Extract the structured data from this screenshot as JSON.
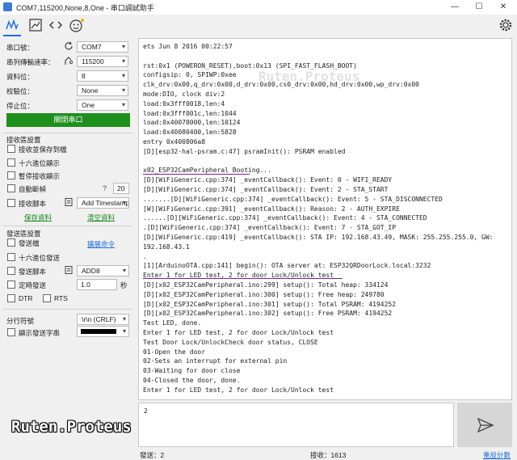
{
  "window": {
    "title": "COM7,115200,None,8,One - 串口調試助手",
    "minimize": "—",
    "maximize": "☐",
    "close": "✕"
  },
  "toolbar": {
    "icons": [
      "waveform-icon",
      "chart-icon",
      "code-icon",
      "emoji-icon"
    ],
    "settings_icon": "gear-icon"
  },
  "serial": {
    "port_label": "串口號：",
    "port_value": "COM7",
    "baud_label": "串列傳輸速率：",
    "baud_value": "115200",
    "data_bits_label": "資料位：",
    "data_bits_value": "8",
    "parity_label": "校驗位：",
    "parity_value": "None",
    "stop_bits_label": "停止位：",
    "stop_bits_value": "One",
    "close_port_button": "關閉串口"
  },
  "receive": {
    "section_title": "接收區設置",
    "save_to_file": "接收並保存到檔",
    "hex_display": "十六進位顯示",
    "pause_display": "暫停接收顯示",
    "auto_newline": "自動斷幀",
    "auto_newline_value": "20",
    "recv_script": "接收腳本",
    "recv_script_value": "Add Timestamp",
    "save_data_link": "保存資料",
    "clear_data_link": "清空資料"
  },
  "send": {
    "section_title": "發送區設置",
    "send_file": "發送檔",
    "extend_cmd_link": "擴展命令",
    "hex_send": "十六進位發送",
    "send_script": "發送腳本",
    "send_script_value": "ADD8",
    "timed_send": "定時發送",
    "timed_value": "1.0",
    "timed_unit": "秒",
    "dtr": "DTR",
    "rts": "RTS",
    "line_end_label": "分行符號",
    "line_end_value": "\\r\\n (CRLF)",
    "show_send_label": "顯示發送字串"
  },
  "console_lines": [
    "ets Jun  8 2016 00:22:57",
    "",
    "rst:0x1 (POWERON_RESET),boot:0x13 (SPI_FAST_FLASH_BOOT)",
    "configsip: 0, SPIWP:0xee",
    "clk_drv:0x00,q_drv:0x00,d_drv:0x00,cs0_drv:0x00,hd_drv:0x00,wp_drv:0x00",
    "mode:DIO, clock div:2",
    "load:0x3fff0018,len:4",
    "load:0x3fff001c,len:1044",
    "load:0x40078000,len:10124",
    "load:0x40080400,len:5828",
    "entry 0x400806a8",
    "[D][esp32-hal-psram.c:47] psramInit(): PSRAM enabled",
    "",
    "x02_ESP32CamPeripheral Booting...",
    "[D][WiFiGeneric.cpp:374] _eventCallback(): Event: 0 - WIFI_READY",
    "[D][WiFiGeneric.cpp:374] _eventCallback(): Event: 2 - STA_START",
    "  .......[D][WiFiGeneric.cpp:374] _eventCallback(): Event: 5 - STA_DISCONNECTED",
    "[W][WiFiGeneric.cpp:391] _eventCallback(): Reason: 2 - AUTH_EXPIRE",
    "  ......[D][WiFiGeneric.cpp:374] _eventCallback(): Event: 4 - STA_CONNECTED",
    ".[D][WiFiGeneric.cpp:374] _eventCallback(): Event: 7 - STA_GOT_IP",
    "[D][WiFiGeneric.cpp:419] _eventCallback(): STA IP: 192.168.43.49, MASK: 255.255.255.0, GW:",
    "192.168.43.1",
    ".",
    "[1][ArduinoOTA.cpp:141] begin(): OTA server at: ESP32QRDoorLock.local:3232",
    "Enter 1 for LED test, 2 for door Lock/Unlock test",
    "[D][x02_ESP32CamPeripheral.ino:299] setup(): Total heap: 334124",
    "[D][x02_ESP32CamPeripheral.ino:300] setup(): Free heap: 249780",
    "[D][x02_ESP32CamPeripheral.ino:301] setup(): Total PSRAM: 4194252",
    "[D][x02_ESP32CamPeripheral.ino:302] setup(): Free PSRAM: 4194252",
    "Test LED, done.",
    "Enter 1 for LED test, 2 for door Lock/Unlock test",
    "Test Door Lock/UnlockCheck door status, CLOSE",
    "01-Open the door",
    "02-Sets an interrupt for external pin",
    "03-Waiting for door close",
    "04-Closed the door, done.",
    "Enter 1 for LED test, 2 for door Lock/Unlock test"
  ],
  "send_input_value": "2",
  "send_button_icon": "send-icon",
  "status": {
    "sent": "發送：2",
    "received": "接收：1613",
    "reset_count_link": "重設計數"
  },
  "watermark": "Ruten.Proteus",
  "colors": {
    "accent_green": "#1d8f1d",
    "link_blue": "#1e6fd9",
    "underline_purple": "#7a1fa0"
  }
}
